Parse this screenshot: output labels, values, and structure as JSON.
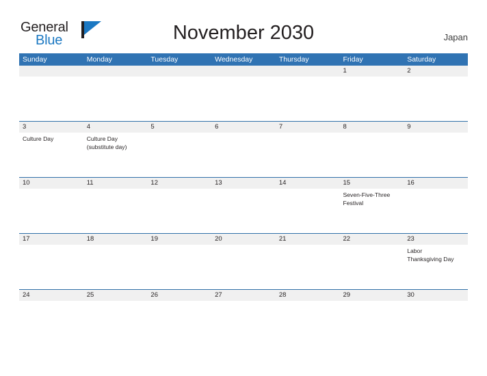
{
  "brand": {
    "name_part1": "General",
    "name_part2": "Blue",
    "flag_icon": "flag-icon",
    "accent_color": "#1b78c2"
  },
  "header": {
    "title": "November 2030",
    "country": "Japan",
    "header_bg_color": "#3073b3",
    "date_band_color": "#f0f0f0"
  },
  "weekdays": [
    "Sunday",
    "Monday",
    "Tuesday",
    "Wednesday",
    "Thursday",
    "Friday",
    "Saturday"
  ],
  "weeks": [
    {
      "dates": [
        "",
        "",
        "",
        "",
        "",
        "1",
        "2"
      ],
      "events": [
        [],
        [],
        [],
        [],
        [],
        [],
        []
      ]
    },
    {
      "dates": [
        "3",
        "4",
        "5",
        "6",
        "7",
        "8",
        "9"
      ],
      "events": [
        [
          "Culture Day"
        ],
        [
          "Culture Day",
          "(substitute day)"
        ],
        [],
        [],
        [],
        [],
        []
      ]
    },
    {
      "dates": [
        "10",
        "11",
        "12",
        "13",
        "14",
        "15",
        "16"
      ],
      "events": [
        [],
        [],
        [],
        [],
        [],
        [
          "Seven-Five-Three",
          "Festival"
        ],
        []
      ]
    },
    {
      "dates": [
        "17",
        "18",
        "19",
        "20",
        "21",
        "22",
        "23"
      ],
      "events": [
        [],
        [],
        [],
        [],
        [],
        [],
        [
          "Labor",
          "Thanksgiving Day"
        ]
      ]
    },
    {
      "dates": [
        "24",
        "25",
        "26",
        "27",
        "28",
        "29",
        "30"
      ],
      "events": [
        [],
        [],
        [],
        [],
        [],
        [],
        []
      ]
    }
  ]
}
